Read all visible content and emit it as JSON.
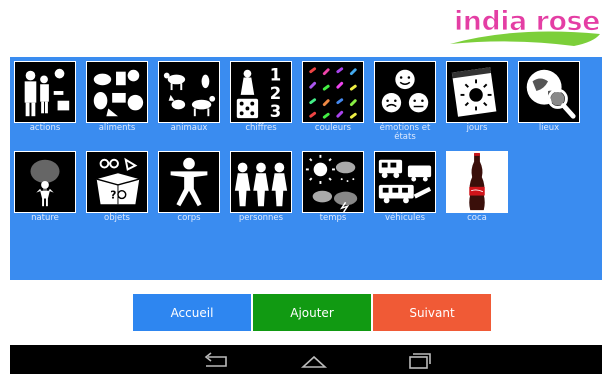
{
  "app": {
    "logo_text": "india rose"
  },
  "tiles": [
    {
      "label": "actions",
      "icon": "actions-icon"
    },
    {
      "label": "aliments",
      "icon": "food-icon"
    },
    {
      "label": "animaux",
      "icon": "animals-icon"
    },
    {
      "label": "chiffres",
      "icon": "numbers-icon"
    },
    {
      "label": "couleurs",
      "icon": "colors-icon"
    },
    {
      "label": "émotions et états",
      "icon": "emotions-icon"
    },
    {
      "label": "jours",
      "icon": "calendar-icon"
    },
    {
      "label": "lieux",
      "icon": "places-icon"
    },
    {
      "label": "nature",
      "icon": "nature-icon"
    },
    {
      "label": "objets",
      "icon": "objects-icon"
    },
    {
      "label": "corps",
      "icon": "body-icon"
    },
    {
      "label": "personnes",
      "icon": "people-icon"
    },
    {
      "label": "temps",
      "icon": "weather-icon"
    },
    {
      "label": "véhicules",
      "icon": "vehicles-icon"
    },
    {
      "label": "coca",
      "icon": "coca-bottle-icon"
    }
  ],
  "buttons": {
    "accueil": "Accueil",
    "ajouter": "Ajouter",
    "suivant": "Suivant"
  },
  "navbar": {
    "back": "back-icon",
    "home": "home-icon",
    "recents": "recents-icon"
  },
  "colors": {
    "panel": "#3a8cf0",
    "accueil": "#2e86f0",
    "ajouter": "#119a12",
    "suivant": "#f05a36",
    "logo": "#e43ea4"
  }
}
